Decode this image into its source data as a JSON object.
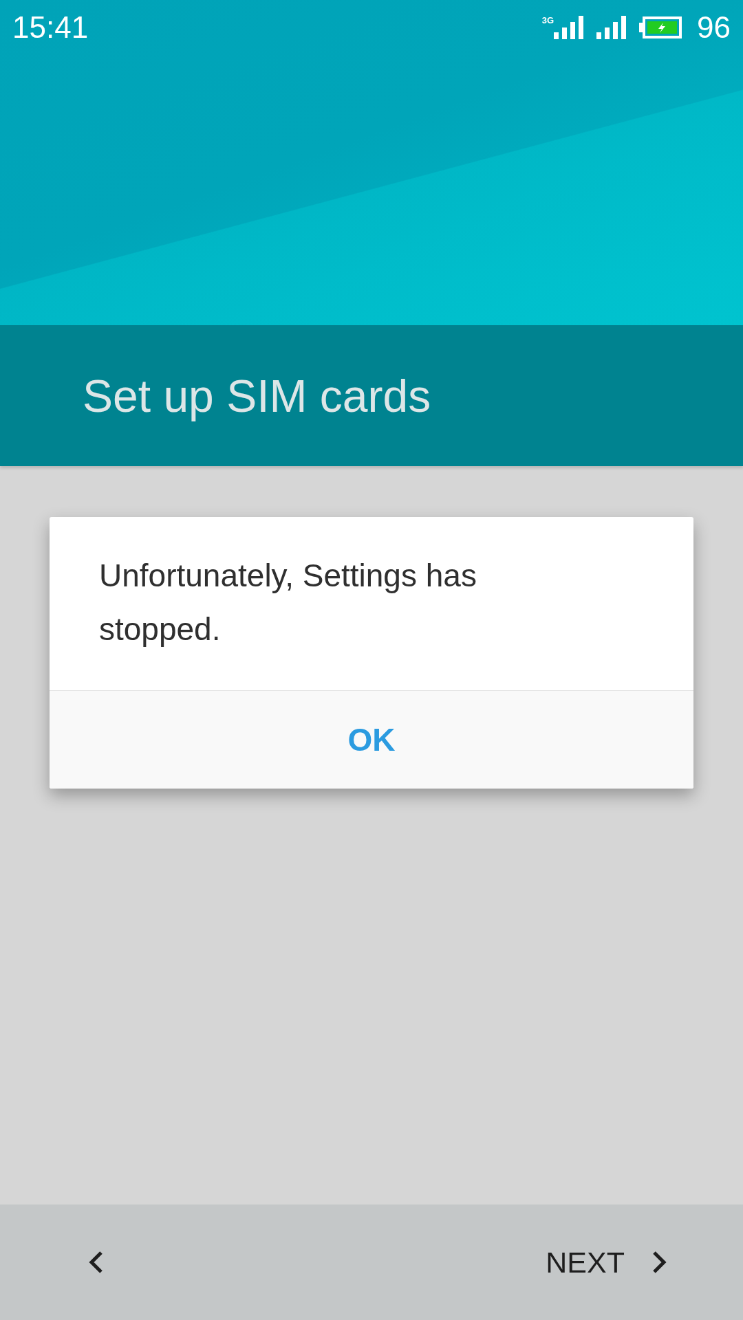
{
  "status_bar": {
    "time": "15:41",
    "network_label": "3G",
    "battery_charging": true,
    "battery_percent": "96"
  },
  "header": {
    "title": "Set up SIM cards"
  },
  "dialog": {
    "message": "Unfortunately, Settings has stopped.",
    "buttons": [
      "OK"
    ]
  },
  "bottom_bar": {
    "next_label": "NEXT"
  }
}
